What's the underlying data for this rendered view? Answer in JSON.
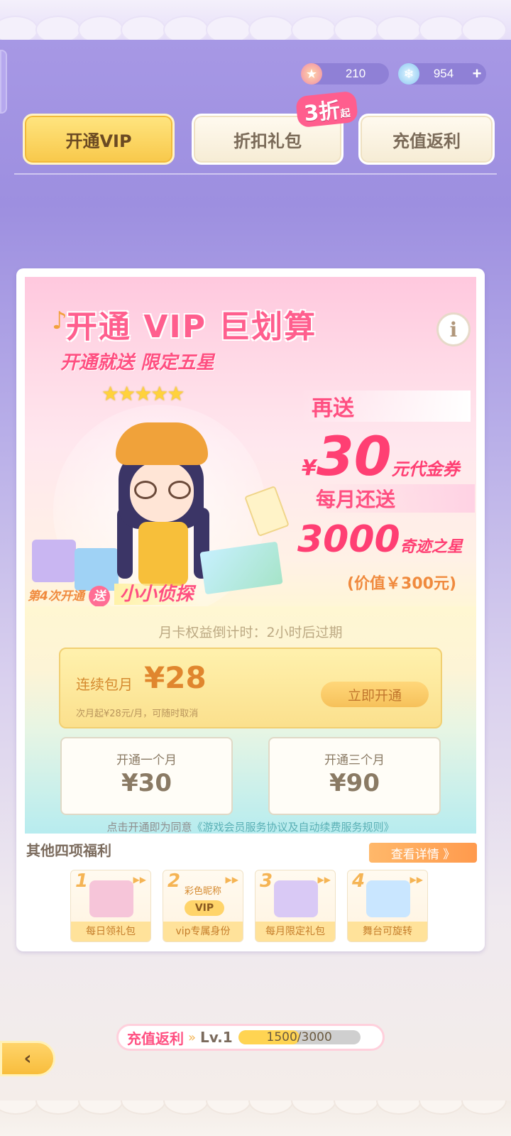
{
  "currency": {
    "star_value": "210",
    "star_icon": "pink-star-icon",
    "crystal_value": "954",
    "crystal_icon": "crystal-icon",
    "add_icon": "+"
  },
  "tabs": [
    {
      "label": "开通VIP",
      "active": true
    },
    {
      "label": "折扣礼包",
      "active": false
    },
    {
      "label": "充值返利",
      "active": false
    }
  ],
  "discount_badge": {
    "main": "3折",
    "suffix": "起"
  },
  "banner": {
    "title": "开通  VIP 巨划算",
    "subtitle": "开通就送 限定五星",
    "stars": "★★★★★",
    "again_send": "再送",
    "coupon_currency": "¥",
    "coupon_amount": "30",
    "coupon_unit": "元代金券",
    "monthly_send": "每月还送",
    "miracle_amount": "3000",
    "miracle_unit": "奇迹之星",
    "worth": "(价值￥300元)",
    "fourth_prefix": "第4次开通",
    "fourth_send": "送",
    "fourth_item": "小小侦探",
    "info_icon": "i"
  },
  "subscription": {
    "countdown": "月卡权益倒计时：2小时后过期",
    "continuous_label": "连续包月",
    "continuous_price": "¥28",
    "continuous_note": "次月起¥28元/月，可随时取消",
    "open_button": "立即开通",
    "plans": [
      {
        "label": "开通一个月",
        "price": "¥30"
      },
      {
        "label": "开通三个月",
        "price": "¥90"
      }
    ],
    "agreement_prefix": "点击开通即为同意",
    "agreement_link": "《游戏会员服务协议及自动续费服务规则》"
  },
  "benefits": {
    "title": "其他四项福利",
    "detail_button": "查看详情 》",
    "items": [
      {
        "num": "1",
        "label": "每日领礼包"
      },
      {
        "num": "2",
        "label": "vip专属身份",
        "nick": "彩色昵称",
        "badge": "VIP"
      },
      {
        "num": "3",
        "label": "每月限定礼包"
      },
      {
        "num": "4",
        "label": "舞台可旋转"
      }
    ]
  },
  "level_bar": {
    "title": "充值返利",
    "level": "Lv.1",
    "progress_text": "1500/3000",
    "progress": 0.5
  }
}
